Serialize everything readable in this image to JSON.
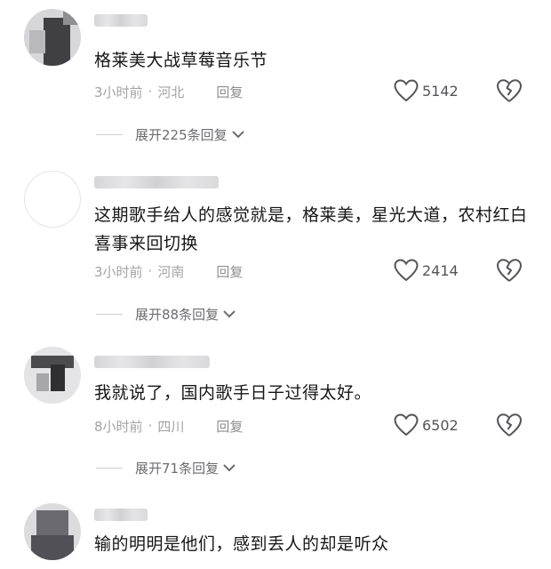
{
  "comments": [
    {
      "text": "格莱美大战草莓音乐节",
      "time": "3小时前",
      "location": "河北",
      "reply_label": "回复",
      "likes": "5142",
      "expand_label": "展开225条回复"
    },
    {
      "text": "这期歌手给人的感觉就是，格莱美，星光大道，农村红白喜事来回切换",
      "time": "3小时前",
      "location": "河南",
      "reply_label": "回复",
      "likes": "2414",
      "expand_label": "展开88条回复"
    },
    {
      "text": "我就说了，国内歌手日子过得太好。",
      "time": "8小时前",
      "location": "四川",
      "reply_label": "回复",
      "likes": "6502",
      "expand_label": "展开71条回复"
    },
    {
      "text": "输的明明是他们，感到丢人的却是听众"
    }
  ],
  "separator": "·",
  "icons": {
    "like": "heart-outline-icon",
    "dislike": "broken-heart-icon",
    "expand": "chevron-down-icon"
  },
  "colors": {
    "text": "#161616",
    "meta": "#a3a3a6",
    "icon": "#555559",
    "background": "#ffffff"
  }
}
